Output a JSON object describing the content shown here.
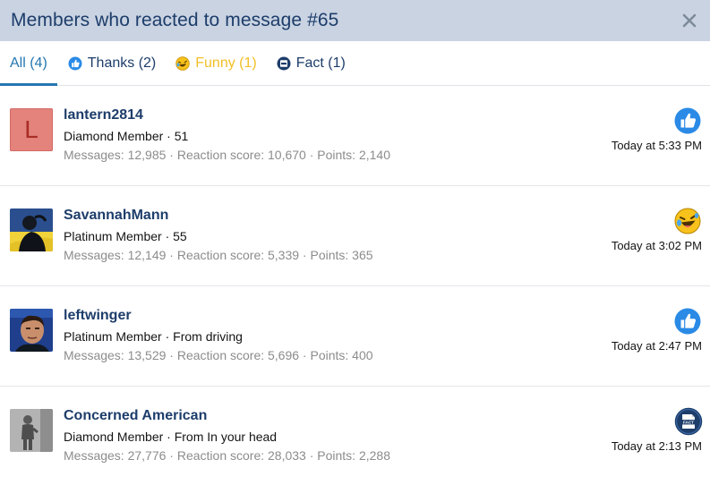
{
  "header": {
    "title": "Members who reacted to message #65"
  },
  "tabs": [
    {
      "label": "All (4)",
      "icon": ""
    },
    {
      "label": "Thanks (2)",
      "icon": "thumbs-up-icon"
    },
    {
      "label": "Funny (1)",
      "icon": "laughing-emoji-icon"
    },
    {
      "label": "Fact (1)",
      "icon": "fact-badge-icon"
    }
  ],
  "colors": {
    "accent": "#2577b1",
    "header_bg": "#c9d3e2",
    "title": "#1d3d6a",
    "funny": "#f2bf26",
    "muted": "#8c8c8c"
  },
  "members": [
    {
      "name": "lantern2814",
      "avatar_letter": "L",
      "title_line": "Diamond Member · 51",
      "stats": "Messages: 12,985 · Reaction score: 10,670 · Points: 2,140",
      "time": "Today at 5:33 PM",
      "reaction": "thumbs-up-icon"
    },
    {
      "name": "SavannahMann",
      "title_line": "Platinum Member · 55",
      "stats": "Messages: 12,149 · Reaction score: 5,339 · Points: 365",
      "time": "Today at 3:02 PM",
      "reaction": "laughing-emoji-icon"
    },
    {
      "name": "leftwinger",
      "title_line": "Platinum Member · From driving",
      "stats": "Messages: 13,529 · Reaction score: 5,696 · Points: 400",
      "time": "Today at 2:47 PM",
      "reaction": "thumbs-up-icon"
    },
    {
      "name": "Concerned American",
      "title_line": "Diamond Member · From In your head",
      "stats": "Messages: 27,776 · Reaction score: 28,033 · Points: 2,288",
      "time": "Today at 2:13 PM",
      "reaction": "fact-badge-icon"
    }
  ]
}
